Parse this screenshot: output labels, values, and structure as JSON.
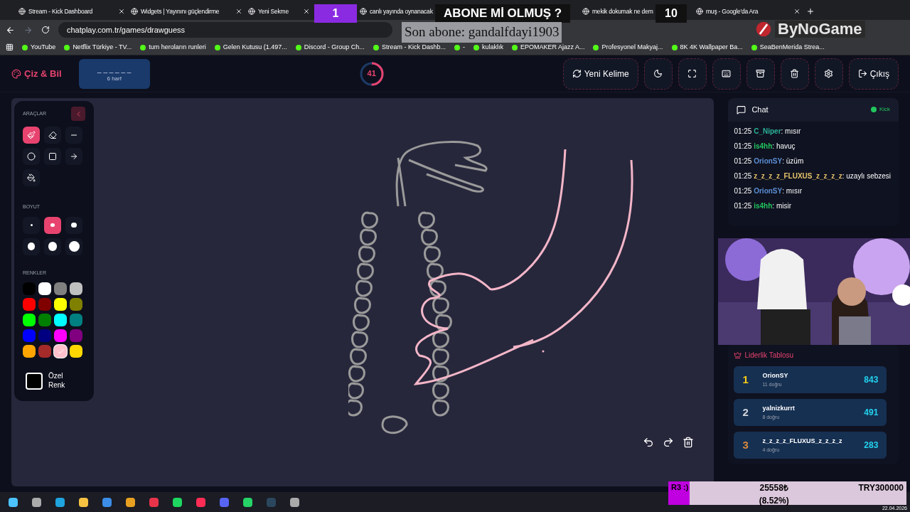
{
  "browser": {
    "tabs": [
      {
        "title": "Stream - Kick Dashboard"
      },
      {
        "title": "Widgets | Yayınını güçlendirme"
      },
      {
        "title": "Yeni Sekme"
      },
      {
        "title": "canlı yayında oynanacak"
      },
      {
        "title": "mekik dokumak ne dem"
      },
      {
        "title": "muş - Google'da Ara"
      }
    ],
    "url": "chatplay.com.tr/games/drawguess",
    "bookmarks": [
      "YouTube",
      "Netflix Türkiye - TV...",
      "tum heroların runleri",
      "Gelen Kutusu (1.497...",
      "Discord - Group Ch...",
      "Stream - Kick Dashb...",
      "-",
      "kulaklık",
      "EPOMAKER Ajazz A...",
      "Profesyonel Makyaj...",
      "8K 4K Wallpaper Ba...",
      "SeaBenMerida Strea..."
    ]
  },
  "app": {
    "title": "Çiz & Bil",
    "word": "_ _ _ _ _ _",
    "word_hint": "6 harf",
    "timer": {
      "value": "41",
      "level": 0.5
    },
    "header_buttons": [
      {
        "kind": "new-word",
        "label": "Yeni Kelime"
      },
      {
        "kind": "theme"
      },
      {
        "kind": "fullscreen"
      },
      {
        "kind": "keyboard"
      },
      {
        "kind": "archive"
      },
      {
        "kind": "delete"
      },
      {
        "kind": "settings"
      },
      {
        "kind": "logout",
        "label": "Çıkış"
      }
    ],
    "tools_title": "ARAÇLAR",
    "tools": [
      {
        "kind": "brush",
        "selected": true
      },
      {
        "kind": "eraser",
        "selected": false
      },
      {
        "kind": "line",
        "selected": false
      },
      {
        "kind": "circle",
        "selected": false
      },
      {
        "kind": "rect",
        "selected": false
      },
      {
        "kind": "arrow",
        "selected": false
      },
      {
        "kind": "fill",
        "selected": false
      }
    ],
    "size_title": "BOYUT",
    "sizes": [
      {
        "selected": false
      },
      {
        "selected": true
      },
      {
        "selected": false
      },
      {
        "selected": false
      },
      {
        "selected": false
      },
      {
        "selected": false
      }
    ],
    "colors_title": "RENKLER",
    "colors": [
      {
        "color": "#000000",
        "selected": false
      },
      {
        "color": "#ffffff",
        "selected": false
      },
      {
        "color": "#808080",
        "selected": false
      },
      {
        "color": "#c0c0c0",
        "selected": false
      },
      {
        "color": "#ff0000",
        "selected": false
      },
      {
        "color": "#800000",
        "selected": false
      },
      {
        "color": "#ffff00",
        "selected": false
      },
      {
        "color": "#808000",
        "selected": false
      },
      {
        "color": "#00ff00",
        "selected": false
      },
      {
        "color": "#008000",
        "selected": false
      },
      {
        "color": "#00ffff",
        "selected": false
      },
      {
        "color": "#008080",
        "selected": false
      },
      {
        "color": "#0000ff",
        "selected": false
      },
      {
        "color": "#000080",
        "selected": false
      },
      {
        "color": "#ff00ff",
        "selected": false
      },
      {
        "color": "#800080",
        "selected": false
      },
      {
        "color": "#ffa500",
        "selected": false
      },
      {
        "color": "#a52a2a",
        "selected": false
      },
      {
        "color": "#ffc0cb",
        "selected": true
      },
      {
        "color": "#ffd700",
        "selected": false
      }
    ],
    "custom_color": {
      "label": "Özel Renk",
      "color": "#000000"
    },
    "chat": {
      "title": "Chat",
      "source": "Kick",
      "messages": [
        {
          "time": "01:25",
          "user": "C_Niper",
          "color": "#2bb39a",
          "text": ": mısır"
        },
        {
          "time": "01:25",
          "user": "is4hh",
          "color": "#22c55e",
          "text": ": havuç"
        },
        {
          "time": "01:25",
          "user": "OrionSY",
          "color": "#5b8fd6",
          "text": ": üzüm"
        },
        {
          "time": "01:25",
          "user": "z_z_z_z_FLUXUS_z_z_z_z",
          "color": "#e6c36a",
          "text": ": uzaylı sebzesi"
        },
        {
          "time": "01:25",
          "user": "OrionSY",
          "color": "#5b8fd6",
          "text": ": mısır"
        },
        {
          "time": "01:25",
          "user": "is4hh",
          "color": "#22c55e",
          "text": ": misir"
        }
      ]
    },
    "leaderboard": {
      "title": "Liderlik Tablosu",
      "rows": [
        {
          "rank": "1",
          "color": "#facc15",
          "name": "OrionSY",
          "correct": "11 doğru",
          "score": "843"
        },
        {
          "rank": "2",
          "color": "#d1d5db",
          "name": "yalnizkurrt",
          "correct": "8 doğru",
          "score": "491"
        },
        {
          "rank": "3",
          "color": "#d9883a",
          "name": "z_z_z_z_FLUXUS_z_z_z_z",
          "correct": "4 doğru",
          "score": "283"
        }
      ]
    }
  },
  "overlay": {
    "left_count": "1",
    "banner": "ABONE Mİ OLMUŞ ?",
    "right_count": "10",
    "last_sub": "Son abone: gandalfdayi1903",
    "logo": "ByNoGame",
    "goal": {
      "label": "R3 :)",
      "amount": "25558₺",
      "target": "TRY300000",
      "percent": "(8.52%)"
    },
    "date": "22.04.2026"
  }
}
